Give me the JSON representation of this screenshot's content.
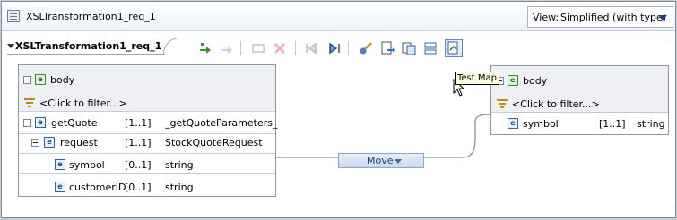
{
  "editor": {
    "tab_title": "XSLTransformation1_req_1",
    "view_label": "View:",
    "view_value": "Simplified (with type)"
  },
  "mapping": {
    "header": "XSLTransformation1_req_1",
    "tooltip": "Test Map",
    "transform_label": "Move"
  },
  "source": {
    "root": "body",
    "filter": "<Click to filter...>",
    "rows": [
      {
        "name": "getQuote",
        "card": "[1..1]",
        "type": "_getQuoteParameters_"
      },
      {
        "name": "request",
        "card": "[1..1]",
        "type": "StockQuoteRequest"
      },
      {
        "name": "symbol",
        "card": "[0..1]",
        "type": "string"
      },
      {
        "name": "customerID",
        "card": "[0..1]",
        "type": "string"
      }
    ]
  },
  "target": {
    "root": "body",
    "filter": "<Click to filter...>",
    "rows": [
      {
        "name": "symbol",
        "card": "[1..1]",
        "type": "string"
      }
    ]
  },
  "toolbar_icons": [
    "add-mapping-icon",
    "remove-mapping-icon",
    "new-transform-icon",
    "delete-icon",
    "previous-icon",
    "next-icon",
    "auto-map-icon",
    "xslt-icon",
    "copy-icon",
    "split-icon",
    "test-map-icon"
  ]
}
